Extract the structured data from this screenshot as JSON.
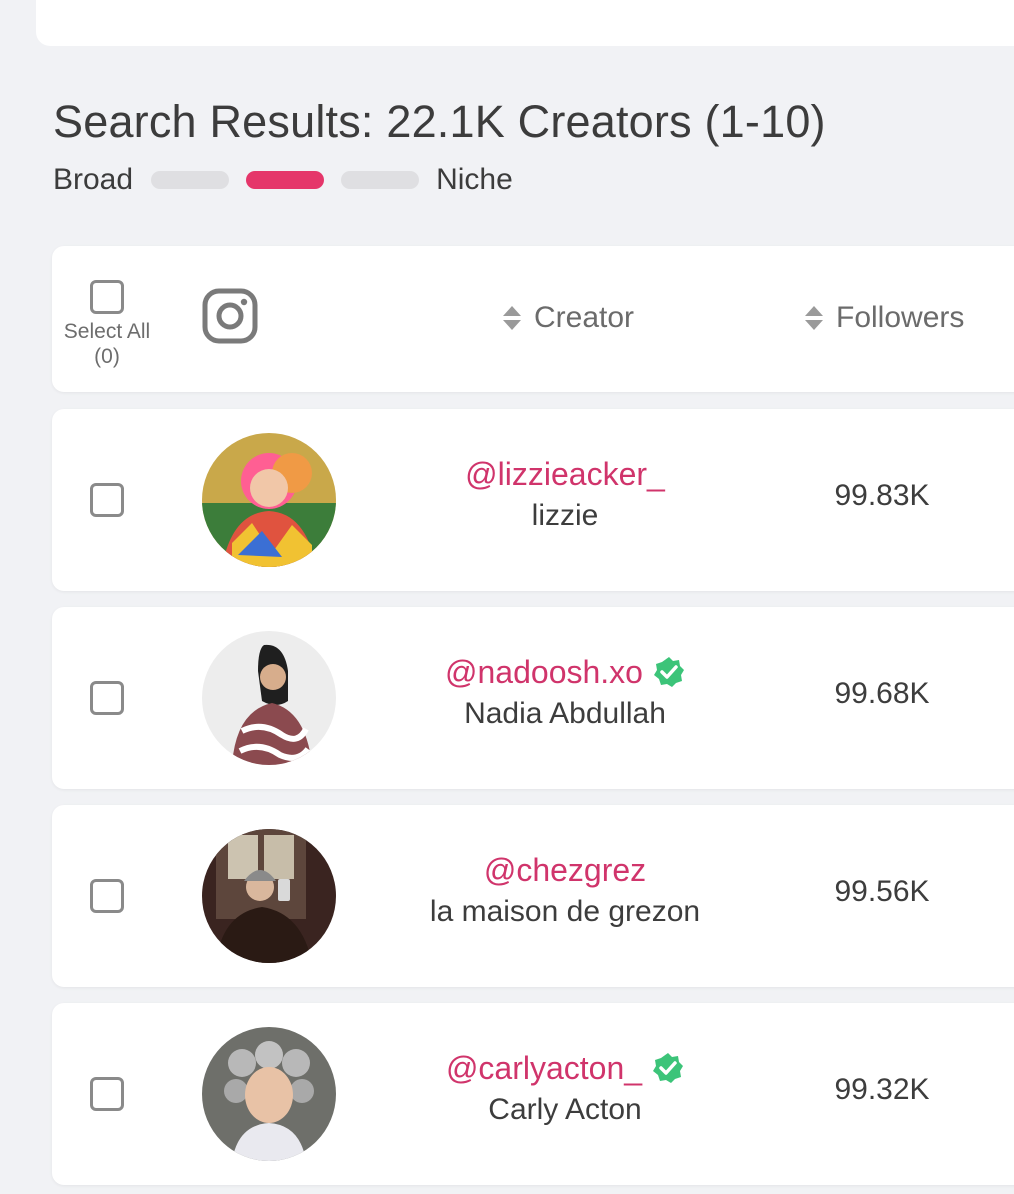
{
  "header": {
    "title": "Search Results: 22.1K Creators (1-10)",
    "slider": {
      "left_label": "Broad",
      "right_label": "Niche",
      "active_index": 1,
      "segments": 3,
      "active_color": "#e5366a"
    }
  },
  "table": {
    "select_all_label": "Select All",
    "select_all_count": "(0)",
    "platform_icon": "instagram-icon",
    "columns": {
      "creator": "Creator",
      "followers": "Followers"
    },
    "rows": [
      {
        "handle": "@lizzieacker_",
        "name": "lizzie",
        "followers": "99.83K",
        "verified": false
      },
      {
        "handle": "@nadoosh.xo",
        "name": "Nadia Abdullah",
        "followers": "99.68K",
        "verified": true
      },
      {
        "handle": "@chezgrez",
        "name": "la maison de grezon",
        "followers": "99.56K",
        "verified": false
      },
      {
        "handle": "@carlyacton_",
        "name": "Carly Acton",
        "followers": "99.32K",
        "verified": true
      }
    ]
  },
  "colors": {
    "accent": "#e5366a",
    "handle": "#d0346b",
    "verified": "#3cc479"
  }
}
